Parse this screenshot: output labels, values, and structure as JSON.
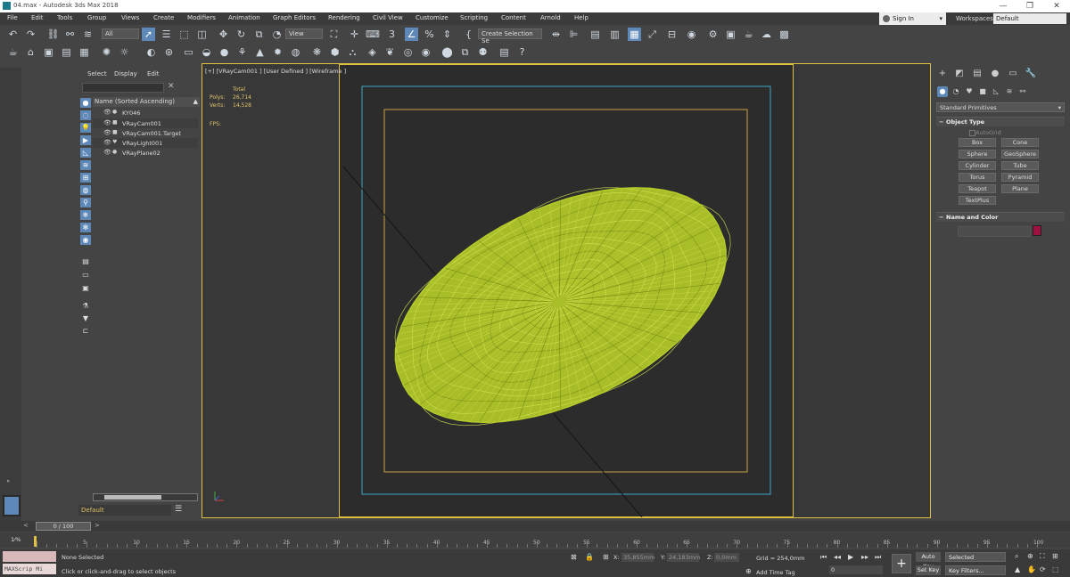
{
  "window": {
    "title": "04.max - Autodesk 3ds Max 2018",
    "controls": [
      "—",
      "❐",
      "✕"
    ]
  },
  "menu": [
    "File",
    "Edit",
    "Tools",
    "Group",
    "Views",
    "Create",
    "Modifiers",
    "Animation",
    "Graph Editors",
    "Rendering",
    "Civil View",
    "Customize",
    "Scripting",
    "Content",
    "Arnold",
    "Help"
  ],
  "account": {
    "signin_label": "Sign In",
    "workspaces_label": "Workspaces:",
    "workspace_value": "Default"
  },
  "toolbar": {
    "selection_filter": "All",
    "ref_coord": "View",
    "named_selection": "Create Selection Se"
  },
  "scene_explorer": {
    "tabs": [
      "Select",
      "Display",
      "Edit"
    ],
    "column_header": "Name (Sorted Ascending)",
    "items": [
      {
        "name": "KY046",
        "type_icon": "sphere-icon"
      },
      {
        "name": "VRayCam001",
        "type_icon": "camera-icon"
      },
      {
        "name": "VRayCam001.Target",
        "type_icon": "target-icon"
      },
      {
        "name": "VRayLight001",
        "type_icon": "light-icon"
      },
      {
        "name": "VRayPlane02",
        "type_icon": "sphere-icon"
      }
    ],
    "layer": "Default"
  },
  "viewport": {
    "label": "[+] [VRayCam001 ] [User Defined ] [Wireframe ]",
    "stats_header": "Total",
    "polys_label": "Polys:",
    "polys_value": "26,714",
    "verts_label": "Verts:",
    "verts_value": "14,528",
    "fps_label": "FPS:",
    "wire_color": "#b6cc2a"
  },
  "command_panel": {
    "category": "Standard Primitives",
    "object_type_title": "Object Type",
    "autogrid_label": "AutoGrid",
    "objects": [
      "Box",
      "Cone",
      "Sphere",
      "GeoSphere",
      "Cylinder",
      "Tube",
      "Torus",
      "Pyramid",
      "Teapot",
      "Plane",
      "TextPlus"
    ],
    "name_color_title": "Name and Color",
    "object_color": "#a01040"
  },
  "time": {
    "slider_label": "0 / 100",
    "ticks": [
      "5",
      "10",
      "15",
      "20",
      "25",
      "30",
      "35",
      "40",
      "45",
      "50",
      "55",
      "60",
      "65",
      "70",
      "75",
      "80",
      "85",
      "90",
      "95",
      "100"
    ],
    "key_indicator": "1⁄%"
  },
  "status": {
    "maxscript": "MAXScrip Mi",
    "selection": "None Selected",
    "prompt": "Click or click-and-drag to select objects",
    "x_label": "X:",
    "x_value": "35,855mm",
    "y_label": "Y:",
    "y_value": "24,183mm",
    "z_label": "Z:",
    "z_value": "0,0mm",
    "grid": "Grid = 254,0mm",
    "add_time_tag": "Add Time Tag",
    "frame_value": "0",
    "auto_key": "Auto Key",
    "set_key": "Set Key",
    "key_mode": "Selected",
    "key_filters": "Key Filters..."
  }
}
